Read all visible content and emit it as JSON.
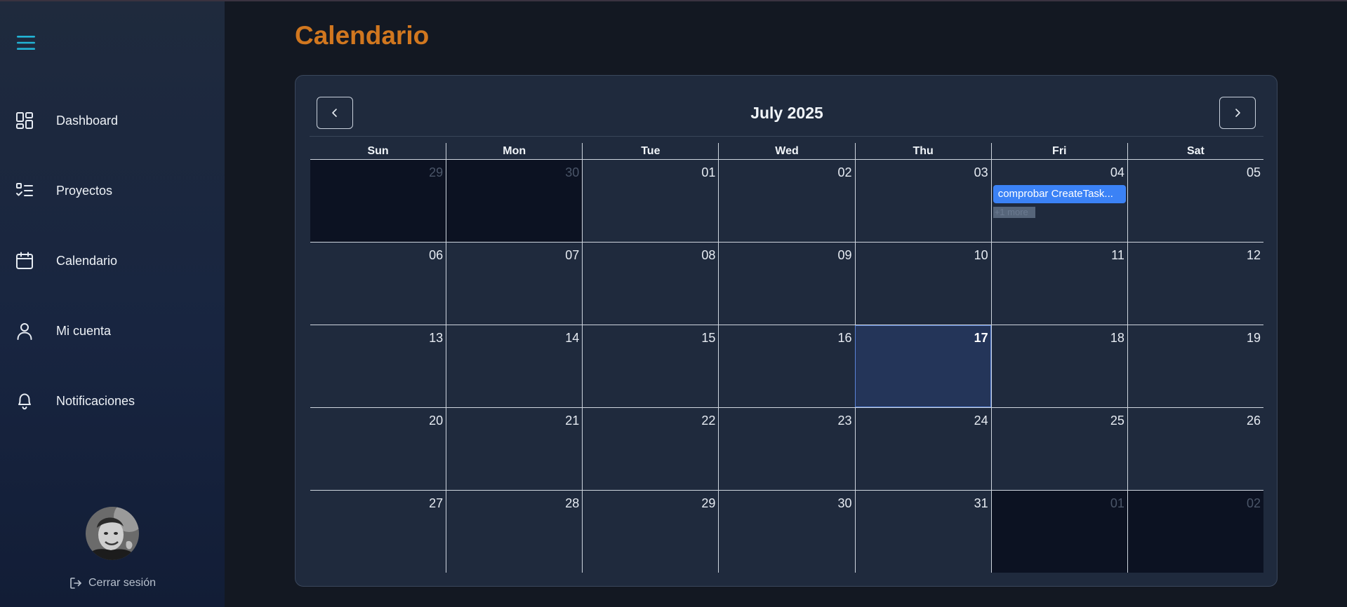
{
  "sidebar": {
    "items": [
      {
        "label": "Dashboard",
        "icon": "dashboard-icon"
      },
      {
        "label": "Proyectos",
        "icon": "checklist-icon"
      },
      {
        "label": "Calendario",
        "icon": "calendar-icon"
      },
      {
        "label": "Mi cuenta",
        "icon": "user-icon"
      },
      {
        "label": "Notificaciones",
        "icon": "bell-icon"
      }
    ],
    "logout_label": "Cerrar sesión"
  },
  "page": {
    "title": "Calendario"
  },
  "calendar": {
    "month_title": "July 2025",
    "days_of_week": [
      "Sun",
      "Mon",
      "Tue",
      "Wed",
      "Thu",
      "Fri",
      "Sat"
    ],
    "weeks": [
      [
        {
          "num": "29",
          "other": true
        },
        {
          "num": "30",
          "other": true
        },
        {
          "num": "01"
        },
        {
          "num": "02"
        },
        {
          "num": "03"
        },
        {
          "num": "04",
          "event": "comprobar CreateTask...",
          "more": "+1 more"
        },
        {
          "num": "05"
        }
      ],
      [
        {
          "num": "06"
        },
        {
          "num": "07"
        },
        {
          "num": "08"
        },
        {
          "num": "09"
        },
        {
          "num": "10"
        },
        {
          "num": "11"
        },
        {
          "num": "12"
        }
      ],
      [
        {
          "num": "13"
        },
        {
          "num": "14"
        },
        {
          "num": "15"
        },
        {
          "num": "16"
        },
        {
          "num": "17",
          "today": true
        },
        {
          "num": "18"
        },
        {
          "num": "19"
        }
      ],
      [
        {
          "num": "20"
        },
        {
          "num": "21"
        },
        {
          "num": "22"
        },
        {
          "num": "23"
        },
        {
          "num": "24"
        },
        {
          "num": "25"
        },
        {
          "num": "26"
        }
      ],
      [
        {
          "num": "27"
        },
        {
          "num": "28"
        },
        {
          "num": "29"
        },
        {
          "num": "30"
        },
        {
          "num": "31"
        },
        {
          "num": "01",
          "other": true
        },
        {
          "num": "02",
          "other": true
        }
      ]
    ]
  },
  "colors": {
    "accent_title": "#d1771f",
    "hamburger": "#22b4d6",
    "event": "#3b82f6",
    "today_bg": "#243559"
  }
}
